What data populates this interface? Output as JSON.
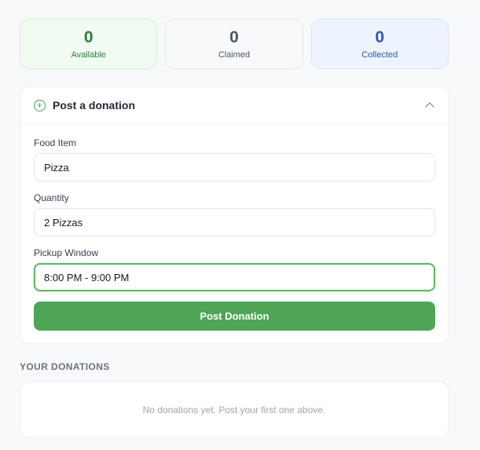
{
  "stats": [
    {
      "value": "0",
      "label": "Available"
    },
    {
      "value": "0",
      "label": "Claimed"
    },
    {
      "value": "0",
      "label": "Collected"
    }
  ],
  "post_card": {
    "title": "Post a donation",
    "icon": "plus-circle-icon",
    "collapse_icon": "chevron-up-icon",
    "fields": [
      {
        "label": "Food Item",
        "value": "Pizza"
      },
      {
        "label": "Quantity",
        "value": "2 Pizzas"
      },
      {
        "label": "Pickup Window",
        "value": "8:00 PM - 9:00 PM"
      }
    ],
    "submit_label": "Post Donation"
  },
  "donations": {
    "section_title": "YOUR DONATIONS",
    "empty_message": "No donations yet. Post your first one above."
  },
  "colors": {
    "accent": "#4ea556",
    "available": "#2f7d3b",
    "collected": "#2c55b4"
  }
}
